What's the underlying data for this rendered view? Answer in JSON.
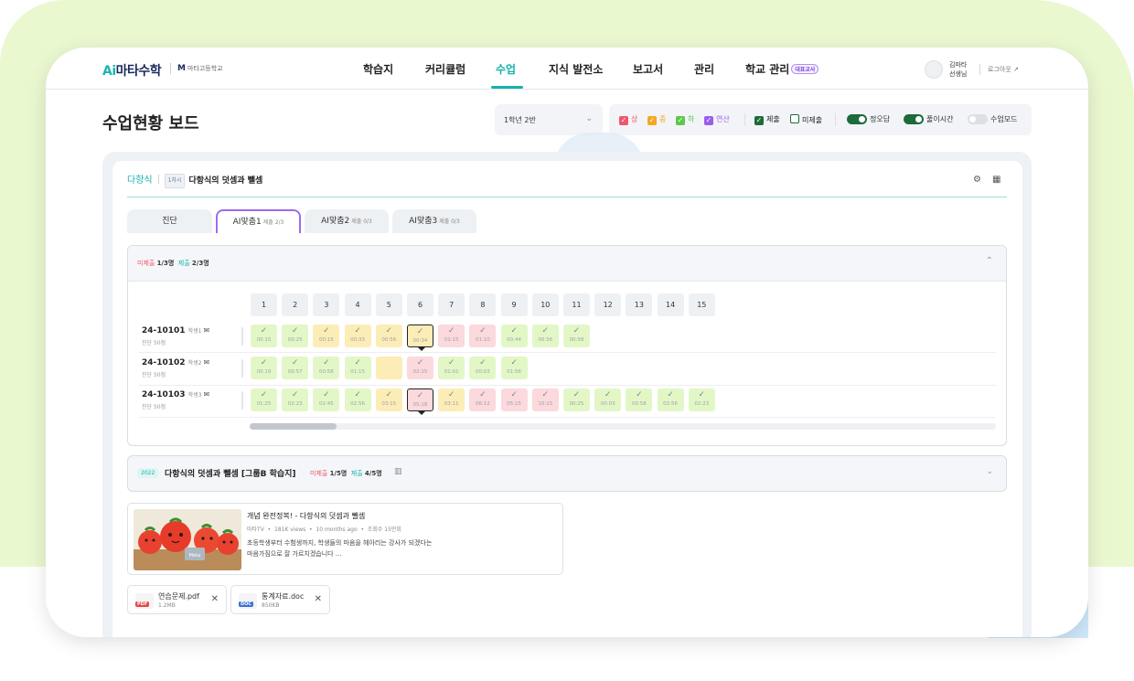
{
  "header": {
    "logo_ai": "Ai",
    "logo_text": "마타수학",
    "school_mark": "M",
    "school_name": "마타고등학교",
    "nav": [
      "학습지",
      "커리큘럼",
      "수업",
      "지식 발전소",
      "보고서",
      "관리",
      "학교 관리"
    ],
    "active_nav": "수업",
    "demo_badge": "대표교사",
    "user_name": "김마타",
    "user_role": "선생님",
    "logout": "로그아웃"
  },
  "page_title": "수업현황 보드",
  "class_select": {
    "value": "1학년 2반"
  },
  "filters": {
    "levels": [
      {
        "label": "상",
        "color": "#f0566a"
      },
      {
        "label": "중",
        "color": "#f5a623"
      },
      {
        "label": "하",
        "color": "#5cc84a"
      },
      {
        "label": "연산",
        "color": "#9b5cf0"
      }
    ],
    "submitted": "제출",
    "unsubmitted": "미제출",
    "toggles": [
      {
        "label": "정오답",
        "on": true
      },
      {
        "label": "풀이시간",
        "on": true
      },
      {
        "label": "수업모드",
        "on": false
      }
    ]
  },
  "lesson": {
    "subject": "다항식",
    "lesson_no": "1차시",
    "title": "다항식의 덧셈과 뺄셈"
  },
  "tabs": [
    {
      "label": "진단",
      "sub": ""
    },
    {
      "label": "AI맞춤1",
      "sub": "제출 2/3"
    },
    {
      "label": "AI맞춤2",
      "sub": "제출 0/3"
    },
    {
      "label": "AI맞춤3",
      "sub": "제출 0/3"
    }
  ],
  "section": {
    "unsubmitted_label": "미제출",
    "unsubmitted_value": "1/3명",
    "submitted_label": "제출",
    "submitted_value": "2/3명"
  },
  "questions": [
    "1",
    "2",
    "3",
    "4",
    "5",
    "6",
    "7",
    "8",
    "9",
    "10",
    "11",
    "12",
    "13",
    "14",
    "15"
  ],
  "students": [
    {
      "id": "24-10101",
      "name": "학생1",
      "sub": "진단 50점",
      "cells": [
        {
          "s": "g",
          "t": "00:15"
        },
        {
          "s": "g",
          "t": "00:25"
        },
        {
          "s": "y",
          "t": "00:15"
        },
        {
          "s": "y",
          "t": "00:33"
        },
        {
          "s": "y",
          "t": "00:56"
        },
        {
          "s": "ysel",
          "t": "00:34"
        },
        {
          "s": "r",
          "t": "01:15"
        },
        {
          "s": "r",
          "t": "01:10"
        },
        {
          "s": "g",
          "t": "00:44"
        },
        {
          "s": "g",
          "t": "00:56"
        },
        {
          "s": "g",
          "t": "00:58"
        }
      ]
    },
    {
      "id": "24-10102",
      "name": "학생2",
      "sub": "진단 50점",
      "cells": [
        {
          "s": "g",
          "t": "00:19"
        },
        {
          "s": "g",
          "t": "00:57"
        },
        {
          "s": "g",
          "t": "00:58"
        },
        {
          "s": "g",
          "t": "01:15"
        },
        {
          "s": "yempty",
          "t": ""
        },
        {
          "s": "r",
          "t": "02:15"
        },
        {
          "s": "g",
          "t": "01:01"
        },
        {
          "s": "g",
          "t": "00:03"
        },
        {
          "s": "g",
          "t": "01:56"
        }
      ]
    },
    {
      "id": "24-10103",
      "name": "학생3",
      "sub": "진단 50점",
      "cells": [
        {
          "s": "g",
          "t": "01:25"
        },
        {
          "s": "g",
          "t": "02:23"
        },
        {
          "s": "g",
          "t": "02:45"
        },
        {
          "s": "g",
          "t": "02:56"
        },
        {
          "s": "y",
          "t": "03:15"
        },
        {
          "s": "rsel",
          "t": "05:18"
        },
        {
          "s": "y",
          "t": "03:11"
        },
        {
          "s": "r",
          "t": "06:12"
        },
        {
          "s": "r",
          "t": "05:15"
        },
        {
          "s": "r",
          "t": "10:15"
        },
        {
          "s": "g",
          "t": "00:25"
        },
        {
          "s": "g",
          "t": "00:03"
        },
        {
          "s": "g",
          "t": "00:58"
        },
        {
          "s": "g",
          "t": "02:56"
        },
        {
          "s": "g",
          "t": "02:23"
        }
      ]
    }
  ],
  "worksheet": {
    "year": "2022",
    "title": "다항식의 덧셈과 뺄셈 [그룹B 학습지]",
    "unsubmitted_label": "미제출",
    "unsubmitted_value": "1/5명",
    "submitted_label": "제출",
    "submitted_value": "4/5명"
  },
  "video": {
    "title": "개념 완전정복! - 다항식의 덧셈과 뺄셈",
    "channel": "마타TV",
    "views": "181K views",
    "ago": "10 months ago",
    "plays": "조회수 15만회",
    "desc1": "초등학생부터 수험생까지, 학생들의 마음을 헤아리는 강사가 되겠다는",
    "desc2": "마음가짐으로 잘 가르치겠습니다 ...",
    "thumb_label": "Meta"
  },
  "files": [
    {
      "name": "연습문제.pdf",
      "size": "1.2MB",
      "ext": "PDF",
      "color": "#e5484d"
    },
    {
      "name": "통계자료.doc",
      "size": "850KB",
      "ext": "DOC",
      "color": "#3b6fd4"
    }
  ]
}
